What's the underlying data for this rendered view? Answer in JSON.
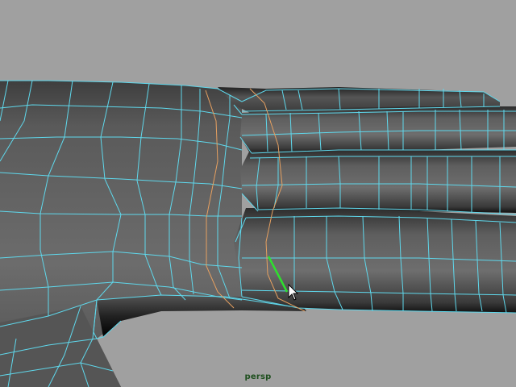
{
  "viewport": {
    "camera_name": "persp",
    "background_color": "#a0a0a0",
    "wireframe_color": "#5fd8ec",
    "edge_loop_color": "#e6a060",
    "selected_edge_color": "#2ee02e",
    "mesh_shading_color": "#666666",
    "cursor_icon": "arrow-pointer-icon"
  }
}
